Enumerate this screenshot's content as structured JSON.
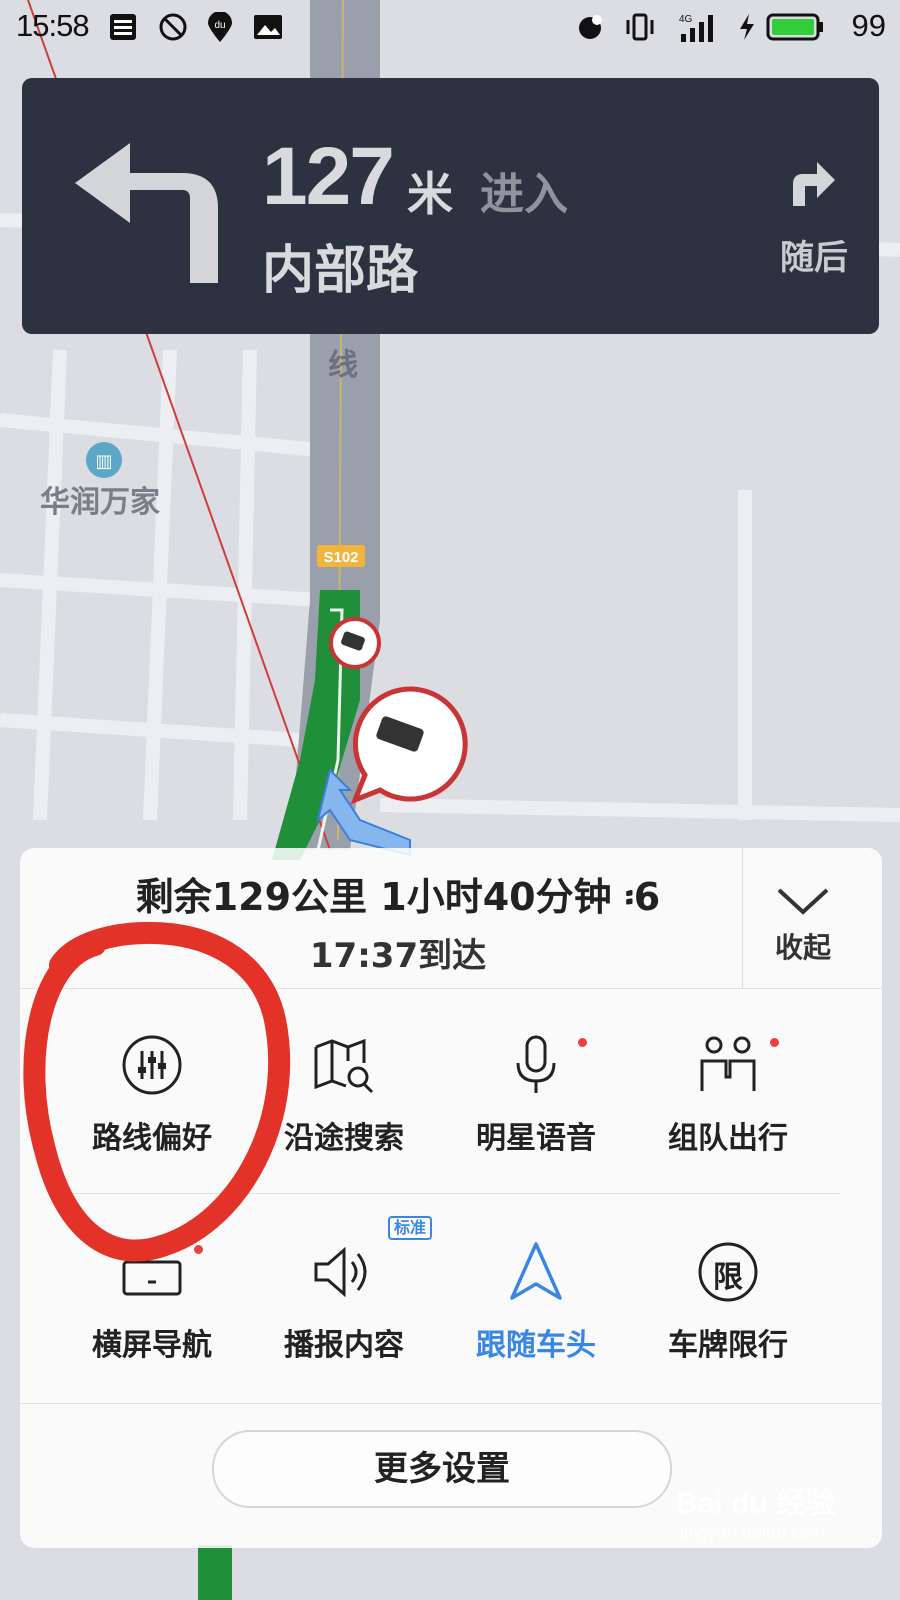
{
  "status_bar": {
    "time": "15:58",
    "battery": "99"
  },
  "nav": {
    "distance": "127",
    "unit": "米",
    "enter": "进入",
    "road": "内部路",
    "then_label": "随后"
  },
  "map": {
    "road_label": "芦线",
    "poi": "华润万家",
    "route_sign": "S102"
  },
  "panel": {
    "remaining": "剩余129公里 1小时40分钟 ፡6",
    "arrival": "17:37到达",
    "collapse_label": "收起",
    "tiles": [
      {
        "label": "路线偏好",
        "icon": "sliders-icon"
      },
      {
        "label": "沿途搜索",
        "icon": "map-search-icon"
      },
      {
        "label": "明星语音",
        "icon": "microphone-icon"
      },
      {
        "label": "组队出行",
        "icon": "team-icon"
      },
      {
        "label": "横屏导航",
        "icon": "landscape-screen-icon"
      },
      {
        "label": "播报内容",
        "icon": "speaker-icon",
        "badge": "标准"
      },
      {
        "label": "跟随车头",
        "icon": "navigation-arrow-icon",
        "active": true
      },
      {
        "label": "车牌限行",
        "icon": "restriction-icon",
        "glyph": "限"
      }
    ],
    "more_settings": "更多设置"
  },
  "watermark": {
    "text": "Bai du 经验",
    "sub": "jingyan.baidu.com"
  },
  "colors": {
    "nav_bg": "#2d3240",
    "active_blue": "#3a86e6",
    "route_green": "#1f8f3a",
    "annotation_red": "#e33227"
  }
}
